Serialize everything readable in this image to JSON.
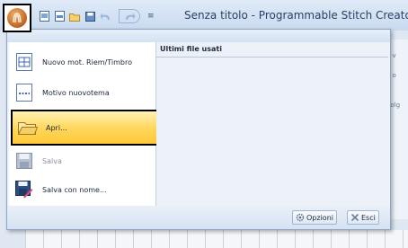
{
  "window": {
    "title": "Senza titolo - Programmable Stitch Creato"
  },
  "quick_access": {
    "more_glyph": "≡"
  },
  "background_fragments": [
    "lgi v",
    "lgi o",
    "ovolg"
  ],
  "menu": {
    "items": [
      {
        "id": "new-fill",
        "label": "Nuovo mot. Riem/Timbro",
        "icon": "new-fill-pattern-icon",
        "enabled": true,
        "highlighted": false
      },
      {
        "id": "new-motif",
        "label": "Motivo nuovotema",
        "icon": "new-motif-icon",
        "enabled": true,
        "highlighted": false
      },
      {
        "id": "open",
        "label": "Apri...",
        "icon": "open-folder-icon",
        "enabled": true,
        "highlighted": true
      },
      {
        "id": "save",
        "label": "Salva",
        "icon": "save-icon",
        "enabled": false,
        "highlighted": false
      },
      {
        "id": "save-as",
        "label": "Salva con nome...",
        "icon": "save-as-icon",
        "enabled": true,
        "highlighted": false
      }
    ],
    "recent_header": "Ultimi file usati",
    "options_label": "Opzioni",
    "exit_label": "Esci"
  },
  "colors": {
    "highlight_top": "#fff1b6",
    "highlight_bottom": "#ffc93a",
    "title_text": "#2a3f66",
    "app_orb": "#c0621d"
  }
}
